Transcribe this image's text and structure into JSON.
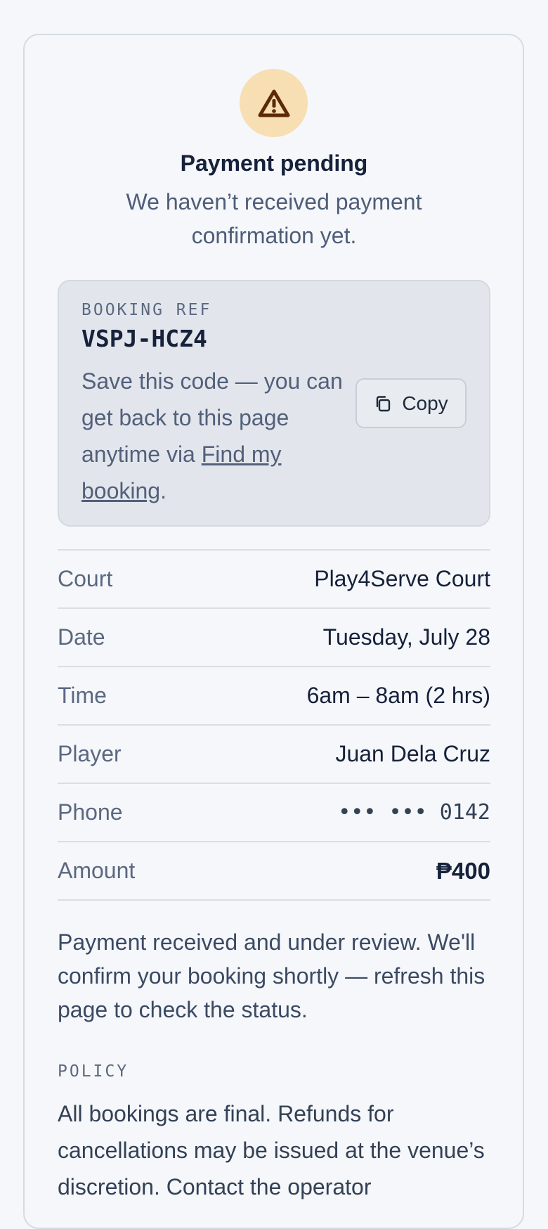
{
  "status": {
    "icon": "warning-triangle-icon",
    "title": "Payment pending",
    "subtitle": "We haven’t received payment confirmation yet."
  },
  "booking_ref": {
    "label": "BOOKING REF",
    "code": "VSPJ-HCZ4",
    "note_prefix": "Save this code — you can get back to this page anytime via ",
    "note_link": "Find my booking",
    "note_suffix": ".",
    "copy_label": "Copy"
  },
  "details": [
    {
      "label": "Court",
      "value": "Play4Serve Court"
    },
    {
      "label": "Date",
      "value": "Tuesday, July 28"
    },
    {
      "label": "Time",
      "value": "6am – 8am (2 hrs)"
    },
    {
      "label": "Player",
      "value": "Juan Dela Cruz"
    },
    {
      "label": "Phone",
      "value": "••• ••• 0142"
    },
    {
      "label": "Amount",
      "value": "₱400"
    }
  ],
  "review_message": "Payment received and under review. We'll confirm your booking shortly — refresh this page to check the status.",
  "policy": {
    "label": "POLICY",
    "text": "All bookings are final. Refunds for cancellations may be issued at the venue’s discretion. Contact the operator"
  },
  "colors": {
    "warning_bg": "#f8deb3",
    "warning_fg": "#5c2a05"
  }
}
